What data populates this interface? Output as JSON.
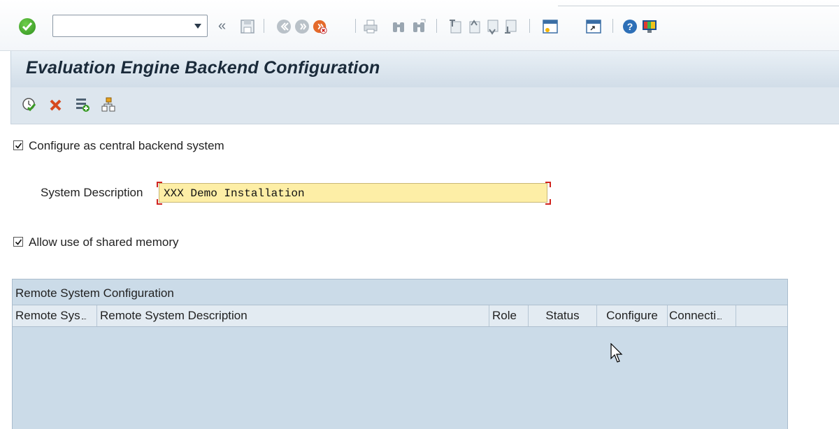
{
  "toolbar": {
    "command_field_value": "",
    "command_field_placeholder": ""
  },
  "title": "Evaluation Engine Backend Configuration",
  "form": {
    "central_backend": {
      "label": "Configure as central backend system",
      "checked": true
    },
    "system_description": {
      "label": "System Description",
      "value": "XXX Demo Installation"
    },
    "shared_memory": {
      "label": "Allow use of shared memory",
      "checked": true
    }
  },
  "remote_config": {
    "title": "Remote System Configuration",
    "columns": [
      "Remote Sys",
      "Remote System Description",
      "Role",
      "Status",
      "Configure",
      "Connecti"
    ],
    "rows": []
  },
  "colors": {
    "title_bar": "#d9e4ee",
    "input_highlight": "#fdeea6",
    "required_marker": "#d1231d",
    "table_bg": "#cbdbe8"
  }
}
